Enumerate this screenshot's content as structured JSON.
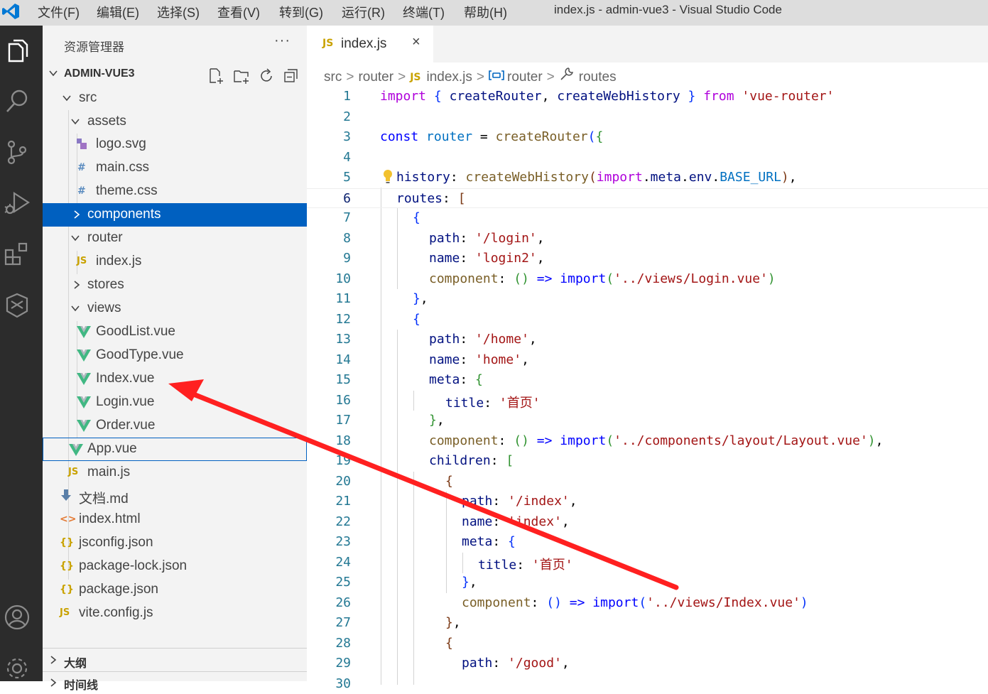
{
  "window": {
    "title": "index.js - admin-vue3 - Visual Studio Code",
    "menu": [
      "文件(F)",
      "编辑(E)",
      "选择(S)",
      "查看(V)",
      "转到(G)",
      "运行(R)",
      "终端(T)",
      "帮助(H)"
    ]
  },
  "activity_bar": {
    "items": [
      "files-icon",
      "search-icon",
      "source-control-icon",
      "run-debug-icon",
      "extensions-icon",
      "remote-icon"
    ],
    "bottom": [
      "account-icon",
      "settings-gear-icon"
    ]
  },
  "explorer": {
    "title": "资源管理器",
    "more": "···",
    "project": "ADMIN-VUE3",
    "tree": [
      {
        "label": "src",
        "kind": "folder-open"
      },
      {
        "label": "assets",
        "kind": "folder-open"
      },
      {
        "label": "logo.svg",
        "kind": "svg"
      },
      {
        "label": "main.css",
        "kind": "css",
        "icon": "#"
      },
      {
        "label": "theme.css",
        "kind": "css",
        "icon": "#"
      },
      {
        "label": "components",
        "kind": "folder-closed",
        "selected": true
      },
      {
        "label": "router",
        "kind": "folder-open"
      },
      {
        "label": "index.js",
        "kind": "js",
        "icon": "JS"
      },
      {
        "label": "stores",
        "kind": "folder-closed"
      },
      {
        "label": "views",
        "kind": "folder-open"
      },
      {
        "label": "GoodList.vue",
        "kind": "vue"
      },
      {
        "label": "GoodType.vue",
        "kind": "vue"
      },
      {
        "label": "Index.vue",
        "kind": "vue"
      },
      {
        "label": "Login.vue",
        "kind": "vue"
      },
      {
        "label": "Order.vue",
        "kind": "vue"
      },
      {
        "label": "App.vue",
        "kind": "vue",
        "focused": true
      },
      {
        "label": "main.js",
        "kind": "js",
        "icon": "JS"
      },
      {
        "label": "文档.md",
        "kind": "md"
      },
      {
        "label": "index.html",
        "kind": "html",
        "icon": "<>"
      },
      {
        "label": "jsconfig.json",
        "kind": "json",
        "icon": "{}"
      },
      {
        "label": "package-lock.json",
        "kind": "json",
        "icon": "{}"
      },
      {
        "label": "package.json",
        "kind": "json",
        "icon": "{}"
      },
      {
        "label": "vite.config.js",
        "kind": "js",
        "icon": "JS"
      }
    ],
    "outline_label": "大纲",
    "timeline_label": "时间线"
  },
  "editor": {
    "tab": {
      "icon": "JS",
      "label": "index.js",
      "close": "×"
    },
    "breadcrumb": {
      "src": "src",
      "router": "router",
      "file_icon": "JS",
      "file": "index.js",
      "symbol1": "router",
      "symbol2": "routes",
      "sep": ">"
    },
    "lines": [
      "1",
      "2",
      "3",
      "4",
      "5",
      "6",
      "7",
      "8",
      "9",
      "10",
      "11",
      "12",
      "13",
      "14",
      "15",
      "16",
      "17",
      "18",
      "19",
      "20",
      "21",
      "22",
      "23",
      "24",
      "25",
      "26",
      "27",
      "28",
      "29",
      "30"
    ],
    "tokens": {
      "import": "import",
      "open_brace": "{",
      "createRouter": "createRouter",
      "comma": ",",
      "createWebHistory": "createWebHistory",
      "close_brace": "}",
      "from": "from",
      "vue_router": "'vue-router'",
      "const": "const",
      "router": "router",
      "eq": "=",
      "open_paren": "(",
      "close_paren": ")",
      "history": "history",
      "colon": ":",
      "dot": ".",
      "meta": "meta",
      "env": "env",
      "base_url": "BASE_URL",
      "routes": "routes",
      "open_bracket": "[",
      "path": "path",
      "name": "name",
      "component": "component",
      "arrow": "=>",
      "parens": "()",
      "children": "children",
      "title": "title",
      "login_path": "'/login'",
      "login_name": "'login2'",
      "login_comp": "'../views/Login.vue'",
      "home_path": "'/home'",
      "home_name": "'home'",
      "home_title": "'首页'",
      "layout_comp": "'../components/layout/Layout.vue'",
      "index_path": "'/index'",
      "index_name": "'index'",
      "index_comp": "'../views/Index.vue'",
      "good_path": "'/good'"
    }
  },
  "colors": {
    "activity_bar": "#2c2c2c",
    "sidebar": "#f3f3f3",
    "selection": "#0060c0",
    "annotation_arrow": "#ff2020",
    "keyword": "#af00db",
    "string": "#a31515",
    "function": "#795e26",
    "variable": "#001080"
  },
  "annotation": {
    "type": "red-arrow",
    "from": "line 26 import path",
    "to": "Index.vue in explorer"
  }
}
